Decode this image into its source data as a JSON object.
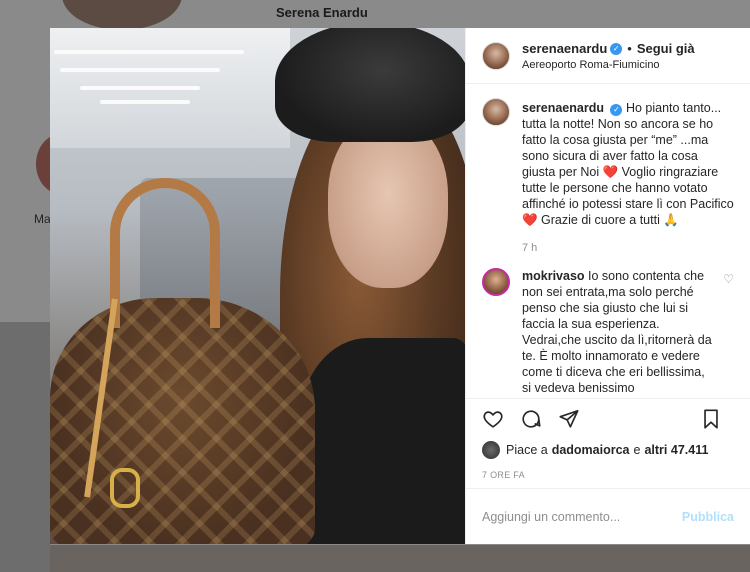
{
  "background": {
    "profile_name": "Serena Enardu",
    "story_label": "Ma"
  },
  "header": {
    "username": "serenaenardu",
    "separator": "•",
    "follow_label": "Segui già",
    "location": "Aereoporto Roma-Fiumicino"
  },
  "caption": {
    "username": "serenaenardu",
    "text": "Ho pianto tanto... tutta la notte! Non so ancora se ho fatto la cosa giusta per “me” ...ma sono sicura di aver fatto la cosa giusta per Noi",
    "text2": " Voglio ringraziare tutte le persone che hanno votato affinché io potessi stare lì con Pacifico",
    "text3": " Grazie di cuore a tutti ",
    "heart": "❤️",
    "pray": "🙏",
    "time": "7 h"
  },
  "comment": {
    "username": "mokrivaso",
    "text": "Io sono contenta che non sei entrata,ma solo perché penso che sia giusto che lui si faccia la sua esperienza. Vedrai,che uscito da lì,ritornerà da te. È molto innamorato e vedere come ti diceva che eri bellissima, si vedeva benissimo"
  },
  "likes": {
    "prefix": "Piace a",
    "user": "dadomaiorca",
    "suffix": "e",
    "others": "altri 47.411"
  },
  "post_time": "7 ORE FA",
  "add_comment": {
    "placeholder": "Aggiungi un commento...",
    "publish_label": "Pubblica"
  },
  "colors": {
    "verified": "#3897f0",
    "publish": "#b2dffc",
    "heart": "#ed4956"
  }
}
